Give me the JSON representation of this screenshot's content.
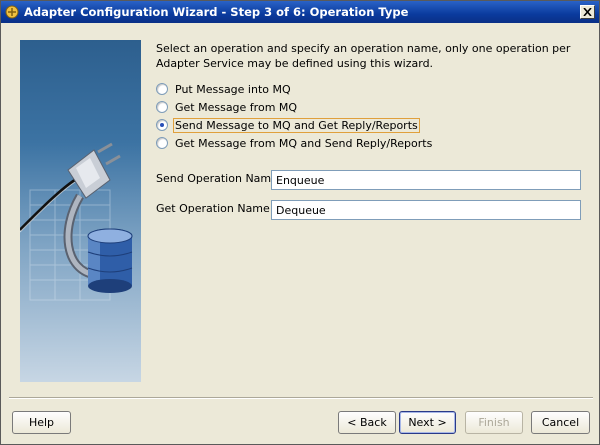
{
  "window": {
    "title": "Adapter Configuration Wizard - Step 3 of 6: Operation Type"
  },
  "intro": {
    "text": "Select an operation and specify an operation name, only one operation per Adapter Service may be defined using this wizard."
  },
  "operations": [
    {
      "label": "Put Message into MQ",
      "selected": false
    },
    {
      "label": "Get Message from MQ",
      "selected": false
    },
    {
      "label": "Send Message to MQ and Get Reply/Reports",
      "selected": true
    },
    {
      "label": "Get Message from MQ and Send Reply/Reports",
      "selected": false
    }
  ],
  "fields": {
    "send_label": "Send Operation Name",
    "send_value": "Enqueue",
    "get_label": "Get Operation Name",
    "get_value": "Dequeue"
  },
  "buttons": {
    "help": "Help",
    "back": "< Back",
    "next": "Next >",
    "finish": "Finish",
    "cancel": "Cancel"
  },
  "colors": {
    "titlebar": "#0a3b9e",
    "dialog_bg": "#ece9d8",
    "focus_outline": "#e0a03c"
  }
}
